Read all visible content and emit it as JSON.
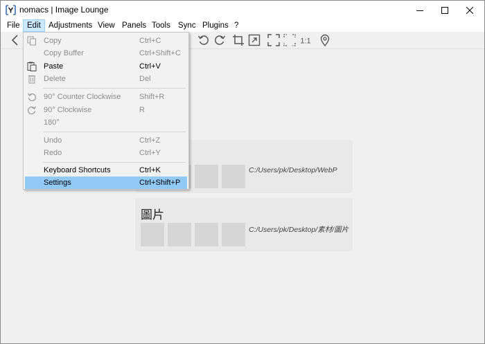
{
  "window": {
    "title": "nomacs | Image Lounge"
  },
  "menubar": {
    "items": [
      "File",
      "Edit",
      "Adjustments",
      "View",
      "Panels",
      "Tools",
      "Sync",
      "Plugins",
      "?"
    ]
  },
  "edit_menu": {
    "items": [
      {
        "label": "Copy",
        "shortcut": "Ctrl+C",
        "icon": "copy-icon",
        "enabled": false
      },
      {
        "label": "Copy Buffer",
        "shortcut": "Ctrl+Shift+C",
        "icon": "",
        "enabled": false
      },
      {
        "label": "Paste",
        "shortcut": "Ctrl+V",
        "icon": "paste-icon",
        "enabled": true
      },
      {
        "label": "Delete",
        "shortcut": "Del",
        "icon": "trash-icon",
        "enabled": false
      },
      {
        "label": "90° Counter Clockwise",
        "shortcut": "Shift+R",
        "icon": "rotate-ccw-icon",
        "enabled": false
      },
      {
        "label": "90° Clockwise",
        "shortcut": "R",
        "icon": "rotate-cw-icon",
        "enabled": false
      },
      {
        "label": "180°",
        "shortcut": "",
        "icon": "",
        "enabled": false
      },
      {
        "label": "Undo",
        "shortcut": "Ctrl+Z",
        "icon": "",
        "enabled": false
      },
      {
        "label": "Redo",
        "shortcut": "Ctrl+Y",
        "icon": "",
        "enabled": false
      },
      {
        "label": "Keyboard Shortcuts",
        "shortcut": "Ctrl+K",
        "icon": "",
        "enabled": true
      },
      {
        "label": "Settings",
        "shortcut": "Ctrl+Shift+P",
        "icon": "",
        "enabled": true,
        "highlighted": true
      }
    ]
  },
  "recent_folders": [
    {
      "title": "",
      "path": "C:/Users/pk/Desktop/WebP"
    },
    {
      "title": "圖片",
      "path": "C:/Users/pk/Desktop/素材/圖片"
    }
  ],
  "colors": {
    "menu_highlight": "#91c9f7",
    "active_menu_bg": "#cce8ff",
    "disabled_text": "#8c8c8c"
  }
}
